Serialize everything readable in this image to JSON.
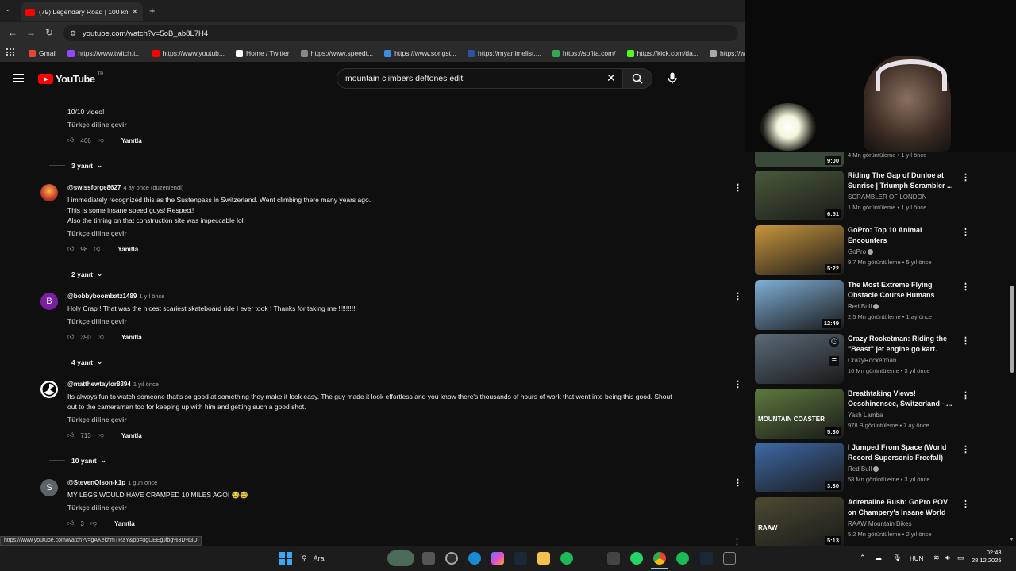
{
  "browser": {
    "tab_title": "(79) Legendary Road | 100 km/",
    "url": "youtube.com/watch?v=5oB_ab8L7H4",
    "bookmarks": [
      {
        "label": "Gmail",
        "color": "#ea4335"
      },
      {
        "label": "https://www.twitch.t...",
        "color": "#9146ff"
      },
      {
        "label": "https://www.youtub...",
        "color": "#ff0000"
      },
      {
        "label": "Home / Twitter",
        "color": "#ffffff"
      },
      {
        "label": "https://www.speedt...",
        "color": "#888888"
      },
      {
        "label": "https://www.songst...",
        "color": "#3a8ee6"
      },
      {
        "label": "https://myanimelist....",
        "color": "#2e51a2"
      },
      {
        "label": "https://sofifa.com/",
        "color": "#34a853"
      },
      {
        "label": "https://kick.com/da...",
        "color": "#53fc18"
      },
      {
        "label": "https://www.ma",
        "color": "#aaaaaa"
      }
    ],
    "status_url": "https://www.youtube.com/watch?v=gAKekhmTRaY&pp=ugUEEgJlbg%3D%3D"
  },
  "youtube": {
    "logo_text": "YouTube",
    "logo_region": "TR",
    "search_query": "mountain climbers deftones edit"
  },
  "comments": {
    "partial": {
      "text": "10/10 video!",
      "translate": "Türkçe diline çevir",
      "likes": "466",
      "reply_label": "Yanıtla",
      "replies": "3 yanıt"
    },
    "items": [
      {
        "author": "@swissforge8627",
        "ago": "4 ay önce (düzenlendi)",
        "lines": [
          "I immediately recognized this as the Sustenpass in Switzerland. Went climbing there many years ago.",
          "This is some insane speed guys! Respect!",
          "Also the timing on that construction site was impeccable lol"
        ],
        "translate": "Türkçe diline çevir",
        "likes": "98",
        "reply_label": "Yanıtla",
        "replies": "2 yanıt",
        "avatar_letter": "",
        "avatar_color": "#b5651d"
      },
      {
        "author": "@bobbyboombatz1489",
        "ago": "1 yıl önce",
        "lines": [
          "Holy Crap ! That was the nicest scariest skateboard ride I ever took ! Thanks for taking me !!!!!!!!!!"
        ],
        "translate": "Türkçe diline çevir",
        "likes": "390",
        "reply_label": "Yanıtla",
        "replies": "4 yanıt",
        "avatar_letter": "B",
        "avatar_color": "#7b1fa2"
      },
      {
        "author": "@matthewtaylor8394",
        "ago": "1 yıl önce",
        "lines": [
          "Its always fun to watch someone that's so good at something they make it look easy. The guy made it look effortless and you know there's thousands of hours of work that went into being this good. Shout",
          "out to the cameraman too for keeping up with him and getting such a good shot."
        ],
        "translate": "Türkçe diline çevir",
        "likes": "713",
        "reply_label": "Yanıtla",
        "replies": "10 yanıt",
        "avatar_letter": "",
        "avatar_color": "#ffffff"
      },
      {
        "author": "@StevenOlson-k1p",
        "ago": "1 gün önce",
        "lines": [
          "MY LEGS WOULD HAVE CRAMPED 10 MILES AGO! 😂😂"
        ],
        "translate": "Türkçe diline çevir",
        "likes": "3",
        "reply_label": "Yanıtla",
        "replies": "",
        "avatar_letter": "S",
        "avatar_color": "#5f6368"
      }
    ]
  },
  "sidebar": {
    "partial_meta": "4 Mn görüntüleme • 1 yıl önce",
    "partial_duration": "9:00",
    "videos": [
      {
        "title": "Riding The Gap of Dunloe at Sunrise | Triumph Scrambler ...",
        "channel": "SCRAMBLER OF LONDON",
        "meta": "1 Mn görüntüleme • 1 yıl önce",
        "duration": "6:51",
        "verified": false,
        "thumb": "#4a5a3a"
      },
      {
        "title": "GoPro: Top 10 Animal Encounters",
        "channel": "GoPro",
        "meta": "9,7 Mn görüntüleme • 5 yıl önce",
        "duration": "5:22",
        "verified": true,
        "thumb": "#c8963c"
      },
      {
        "title": "The Most Extreme Flying Obstacle Course Humans Hav...",
        "channel": "Red Bull",
        "meta": "2,5 Mn görüntüleme • 1 ay önce",
        "duration": "12:49",
        "verified": true,
        "thumb": "#7fb0d8"
      },
      {
        "title": "Crazy Rocketman: Riding the \"Beast\" jet engine go kart.",
        "channel": "CrazyRocketman",
        "meta": "10 Mn görüntüleme • 3 yıl önce",
        "duration": "",
        "verified": false,
        "thumb": "#5a6a78"
      },
      {
        "title": "Breathtaking Views! Oeschinensee, Switzerland - ...",
        "channel": "Yash Lamba",
        "meta": "978 B görüntüleme • 7 ay önce",
        "duration": "5:30",
        "verified": false,
        "thumb": "#5e7a3e",
        "badge": "MOUNTAIN COASTER"
      },
      {
        "title": "I Jumped From Space (World Record Supersonic Freefall)",
        "channel": "Red Bull",
        "meta": "58 Mn görüntüleme • 3 yıl önce",
        "duration": "3:30",
        "verified": true,
        "thumb": "#3e6aa8"
      },
      {
        "title": "Adrenaline Rush: GoPro POV on Champery's Insane World Cup ...",
        "channel": "RAAW Mountain Bikes",
        "meta": "5,2 Mn görüntüleme • 2 yıl önce",
        "duration": "5:13",
        "verified": false,
        "thumb": "#4d4a32",
        "badge": "RAAW"
      }
    ]
  },
  "taskbar": {
    "search_label": "Ara",
    "lang": "HUN",
    "time": "02:43",
    "date": "28.12.2025"
  }
}
